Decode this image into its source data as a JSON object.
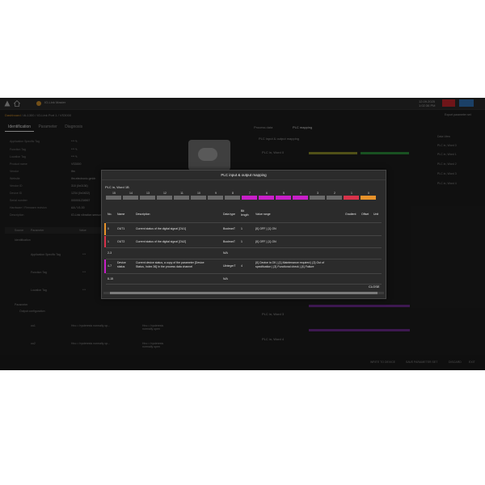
{
  "topbar": {
    "app_name": "IO-Link Master",
    "clock_line1": "12.09.2025",
    "clock_line2": "1:02:36 PM"
  },
  "breadcrumb": {
    "prefix": "Dashboard",
    "path": "/ AL1300 / IO-Link Port 1 / VS3000"
  },
  "tabs": [
    "Identification",
    "Parameter",
    "Diagnosis"
  ],
  "left_props": [
    {
      "label": "Application Specific Tag",
      "value": "*** ✎"
    },
    {
      "label": "Function Tag",
      "value": "*** ✎"
    },
    {
      "label": "Location Tag",
      "value": "*** ✎"
    },
    {
      "label": "Product name",
      "value": "VS3000"
    },
    {
      "label": "Vendor",
      "value": "ifm"
    },
    {
      "label": "Website",
      "value": "ifm.electronic.gmbh"
    },
    {
      "label": "Vendor ID",
      "value": "310 (0x0136)"
    },
    {
      "label": "Device ID",
      "value": "1234 (0x04D2)"
    },
    {
      "label": "Serial number",
      "value": "000001234567"
    },
    {
      "label": "Hardware / Firmware revision",
      "value": "AA / V1.00"
    },
    {
      "label": "Description",
      "value": "IO-Link vibration sensor"
    }
  ],
  "left_table": {
    "headers": [
      "Source",
      "Parameter",
      "Value"
    ],
    "sections": [
      "Identification",
      "Parameter",
      "Output configuration"
    ],
    "rows": [
      {
        "name": "Application Specific Tag",
        "value": "***"
      },
      {
        "name": "Function Tag",
        "value": "***"
      },
      {
        "name": "Location Tag",
        "value": "***"
      },
      {
        "name": "ou1",
        "value": "Hno = hysteresis normally op...",
        "note": "Hno = hysteresis normally open"
      },
      {
        "name": "ou2",
        "value": "Hno = hysteresis normally op...",
        "note": "Hno = hysteresis normally open"
      }
    ]
  },
  "right_panel": {
    "tabs": [
      "Process data",
      "PLC mapping"
    ],
    "title": "PLC input & output mapping",
    "words": [
      "PLC in, Word 0",
      "PLC in, Word 1",
      "PLC in, Word 2",
      "PLC in, Word 3",
      "PLC in, Word 4"
    ]
  },
  "sidebar": {
    "title": "Data View",
    "items": [
      "PLC in, Word 0",
      "PLC in, Word 1",
      "PLC in, Word 2",
      "PLC in, Word 3",
      "PLC in, Word 4"
    ],
    "legend": [
      "OUT1",
      "OUT2",
      "Device status"
    ]
  },
  "export_button": "Export parameter set",
  "bottombar": {
    "items": [
      "WRITE TO DEVICE",
      "SAVE PARAMETER SET",
      "DISCARD",
      "EXIT"
    ]
  },
  "dialog": {
    "title": "PLC input & output mapping",
    "word_label": "PLC in, Word 1B",
    "bits": [
      {
        "n": "15",
        "color": "#6a6a6a"
      },
      {
        "n": "14",
        "color": "#6a6a6a"
      },
      {
        "n": "13",
        "color": "#6a6a6a"
      },
      {
        "n": "12",
        "color": "#6a6a6a"
      },
      {
        "n": "11",
        "color": "#6a6a6a"
      },
      {
        "n": "10",
        "color": "#6a6a6a"
      },
      {
        "n": "9",
        "color": "#6a6a6a"
      },
      {
        "n": "8",
        "color": "#6a6a6a"
      },
      {
        "n": "7",
        "color": "#c81fc8"
      },
      {
        "n": "6",
        "color": "#c81fc8"
      },
      {
        "n": "5",
        "color": "#c81fc8"
      },
      {
        "n": "4",
        "color": "#c81fc8"
      },
      {
        "n": "3",
        "color": "#6a6a6a"
      },
      {
        "n": "2",
        "color": "#6a6a6a"
      },
      {
        "n": "1",
        "color": "#d8324a"
      },
      {
        "n": "0",
        "color": "#e8922a"
      }
    ],
    "headers": {
      "no": "No.",
      "name": "Name",
      "description": "Description",
      "datatype": "Data type",
      "bitlength_1": "Bit",
      "bitlength_2": "length",
      "valuerange": "Value range",
      "gradient": "Gradient",
      "offset": "Offset",
      "unit": "Unit"
    },
    "rows": [
      {
        "no": "0",
        "name": "OUT1",
        "desc1": "Current status of the digital signal [OU1]",
        "desc2": "",
        "datatype": "BooleanT",
        "bitlen": "1",
        "range1": "{0} OFF | {1} ON",
        "range2": "",
        "stripe": "#e8922a"
      },
      {
        "no": "1",
        "name": "OUT2",
        "desc1": "Current status of the digital signal [OU2]",
        "desc2": "",
        "datatype": "BooleanT",
        "bitlen": "1",
        "range1": "{0} OFF | {1} ON",
        "range2": "",
        "stripe": "#d8324a"
      },
      {
        "no": "2-3",
        "name": "",
        "desc1": "",
        "desc2": "",
        "datatype": "N/A",
        "bitlen": "",
        "range1": "",
        "range2": "",
        "stripe": ""
      },
      {
        "no": "4-7",
        "name": "Device",
        "name2": "status",
        "desc1": "Current device status, a copy of the parameter [Device",
        "desc2": "Status, Index 36] in the process data channel",
        "datatype": "UIntegerT",
        "bitlen": "4",
        "range1": "{0} Device is OK | {1} Maintenance required | {2} Out of",
        "range2": "specification | {3} Functional check | {4} Failure",
        "stripe": "#c81fc8"
      },
      {
        "no": "8-15",
        "name": "",
        "desc1": "",
        "desc2": "",
        "datatype": "N/A",
        "bitlen": "",
        "range1": "",
        "range2": "",
        "stripe": ""
      }
    ],
    "close_label": "CLOSE"
  }
}
